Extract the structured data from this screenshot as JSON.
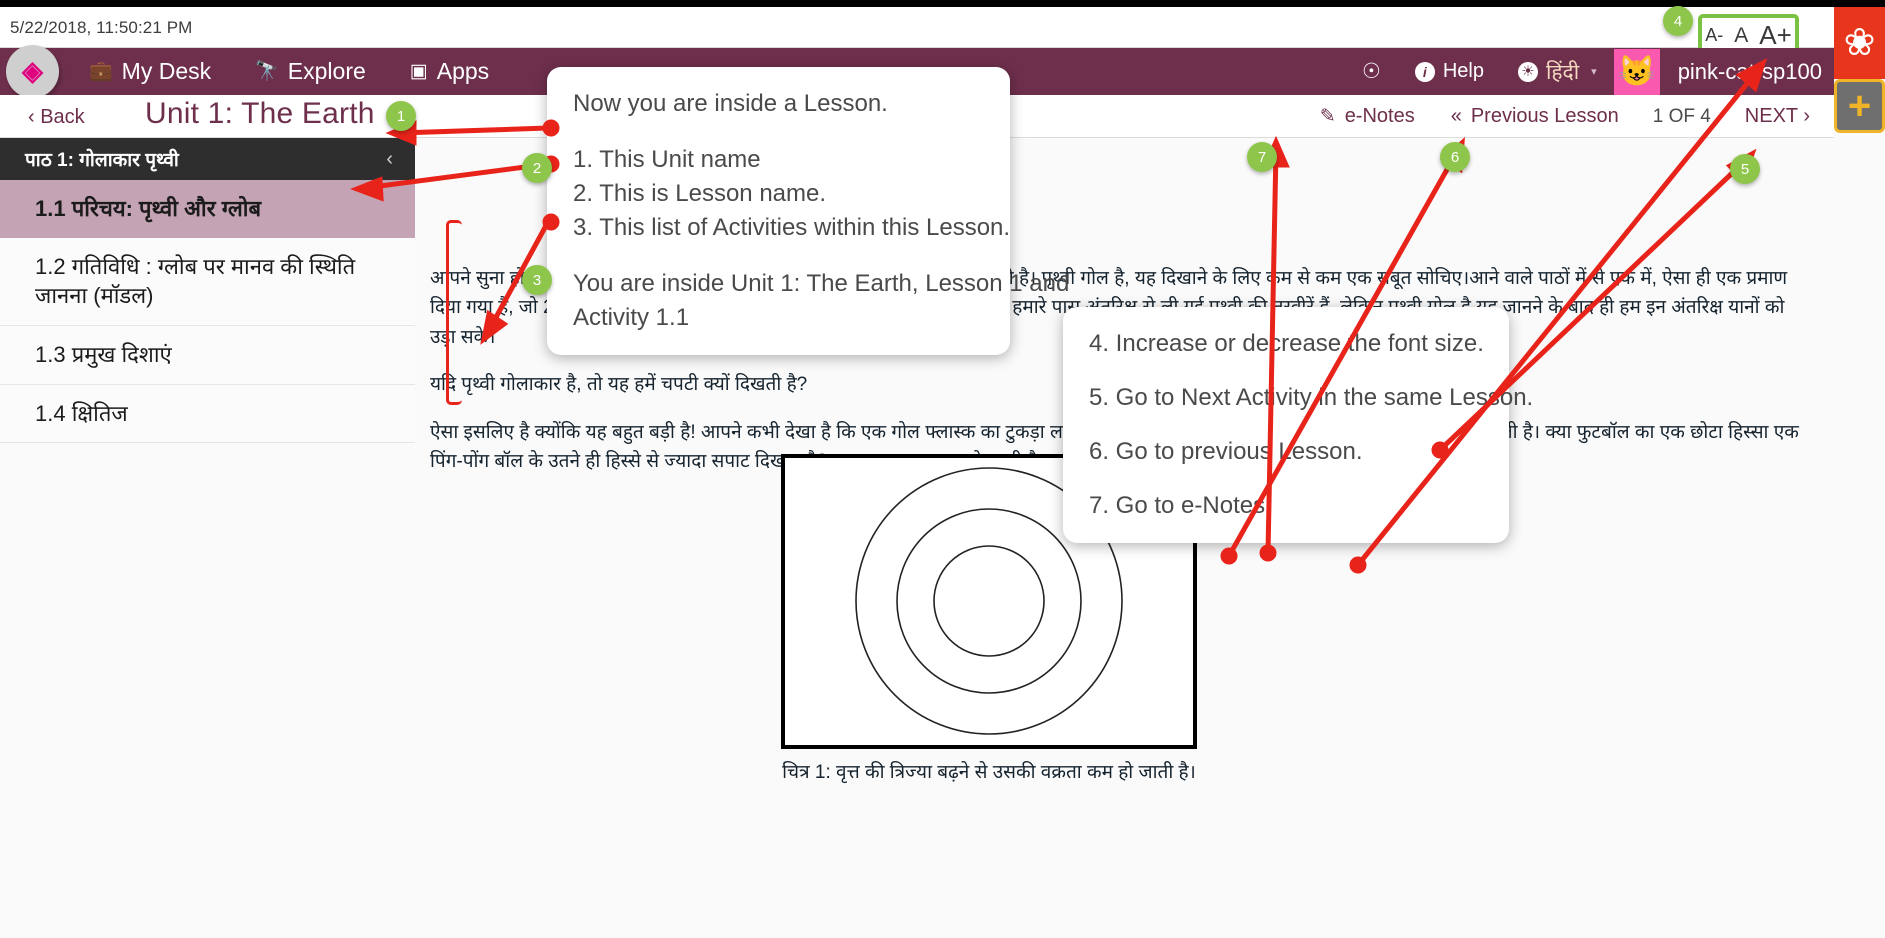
{
  "datetime": "5/22/2018, 11:50:21 PM",
  "font_size_control": {
    "decrease": "A-",
    "normal": "A",
    "increase": "A+"
  },
  "header": {
    "logo_glyph": "S",
    "nav": [
      {
        "label": "My Desk",
        "icon": "briefcase-icon",
        "glyph": "💼"
      },
      {
        "label": "Explore",
        "icon": "binoculars-icon",
        "glyph": "🔭"
      },
      {
        "label": "Apps",
        "icon": "apps-icon",
        "glyph": "▣"
      }
    ],
    "notification_icon": "bell-icon",
    "notification_glyph": "🔔",
    "help_label": "Help",
    "help_icon": "info-icon",
    "help_glyph": "i",
    "language_label": "हिंदी",
    "language_icon": "globe-icon",
    "language_glyph": "🌐",
    "caret_glyph": "▾",
    "username": "pink-cat-sp100",
    "avatar_glyph": "🐱"
  },
  "right_rail": {
    "butterfly_glyph": "🦋",
    "plus_glyph": "+"
  },
  "subbar": {
    "back_label": "‹ Back",
    "unit_title": "Unit 1: The Earth",
    "enotes_label": "e-Notes",
    "enotes_icon": "note-edit-icon",
    "enotes_glyph": "📝",
    "previous_lesson_label": "Previous Lesson",
    "previous_glyph": "«",
    "page_indicator": "1 OF 4",
    "next_label": "NEXT ›"
  },
  "sidebar": {
    "lesson_header": "पाठ 1: गोलाकार पृथ्वी",
    "collapse_glyph": "‹",
    "activities": [
      "1.1 परिचय: पृथ्वी और ग्लोब",
      "1.2 गतिविधि : ग्लोब पर मानव की स्थिति जानना (मॉडल)",
      "1.3 प्रमुख दिशाएं",
      "1.4 क्षितिज"
    ]
  },
  "content": {
    "paragraphs": [
      "आपने सुना होगा कि पृथ्वी गोल है, लेकिन हमारे पैरों के नीचे की जमीन तो चपटी दिखती है। पृथ्वी गोल है, यह दिखाने के लिए कम से कम एक सबूत सोचिए।आने वाले पाठों में से एक में, ऐसा ही एक प्रमाण दिया गया है, जो 2300 साल पहले प्रस्थापित किया गया था। बेशक, अब सबूतों के लिए हमारे पास अंतरिक्ष से ली गई पृथ्वी की तस्वीरें हैं, लेकिन पृथ्वी गोल है यह जानने के बाद ही हम इन अंतरिक्ष यानों को उड़ा सके।",
      "यदि पृथ्वी गोलाकार है, तो यह हमें चपटी क्यों दिखती है?",
      "ऐसा इसलिए है क्योंकि यह बहुत बड़ी है! आपने कभी देखा है कि एक गोल फ्लास्क का टुकड़ा लगभग सपाट लगता है जबकि उसके किनारे अधिक सपाट दिखाई देती है। क्या फुटबॉल का एक छोटा हिस्सा एक पिंग-पोंग बॉल के उतने ही हिस्से से ज्यादा सपाट दिखता है? जब तब वक्रता कम हो जाती है।"
    ],
    "figure_caption": "चित्र 1: वृत्त की त्रिज्या बढ़ने से उसकी वक्रता कम हो जाती है।"
  },
  "callouts": {
    "first": {
      "intro": "Now you are inside a Lesson.",
      "items": [
        "1. This Unit name",
        "2. This is Lesson name.",
        "3. This list of Activities within this Lesson."
      ],
      "footer_line1": "You are inside Unit 1: The Earth, Lesson 1 and",
      "footer_line2": "Activity 1.1"
    },
    "second": {
      "items": [
        "4. Increase or decrease the font size.",
        "5. Go to Next Activity in the same Lesson.",
        "6. Go to previous Lesson.",
        "7. Go to e-Notes"
      ]
    }
  },
  "markers": [
    {
      "id": "1",
      "label": "1"
    },
    {
      "id": "2",
      "label": "2"
    },
    {
      "id": "3",
      "label": "3"
    },
    {
      "id": "4",
      "label": "4"
    },
    {
      "id": "5",
      "label": "5"
    },
    {
      "id": "6",
      "label": "6"
    },
    {
      "id": "7",
      "label": "7"
    }
  ],
  "colors": {
    "brand_purple": "#6e2f4c",
    "annotation_red": "#e8231a",
    "marker_green": "#8ec54b",
    "highlight_green": "#7cc242"
  }
}
